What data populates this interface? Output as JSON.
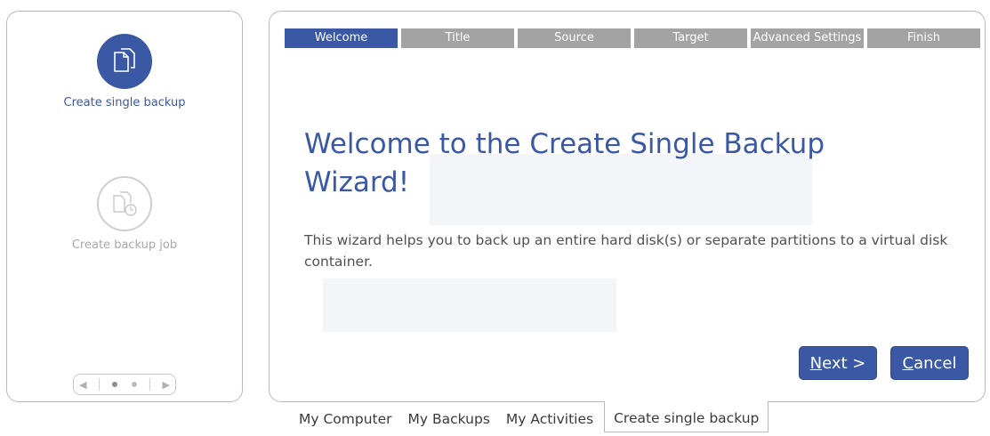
{
  "sidebar": {
    "actions": [
      {
        "label": "Create single backup",
        "icon": "files-icon",
        "active": true
      },
      {
        "label": "Create backup job",
        "icon": "backup-job-clock-icon",
        "active": false
      }
    ],
    "pager": {
      "prev_icon": "chevron-left-icon",
      "next_icon": "chevron-right-icon",
      "pages": 2,
      "current_page": 1
    }
  },
  "wizard": {
    "steps": [
      "Welcome",
      "Title",
      "Source",
      "Target",
      "Advanced Settings",
      "Finish"
    ],
    "active_step": "Welcome",
    "heading": "Welcome to the Create Single Backup Wizard!",
    "description": "This wizard helps you to back up an entire hard disk(s) or separate partitions to a virtual disk container.",
    "next_button": {
      "mnemonic": "N",
      "rest": "ext >"
    },
    "cancel_button": {
      "mnemonic": "C",
      "rest": "ancel"
    }
  },
  "tabs": [
    "My Computer",
    "My Backups",
    "My Activities",
    "Create single backup"
  ],
  "active_tab": "Create single backup",
  "colors": {
    "accent": "#3a58a3",
    "inactive_step": "#a3a3a3",
    "border": "#b9b9b9"
  }
}
